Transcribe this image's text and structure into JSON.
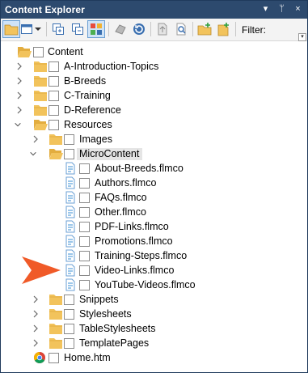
{
  "window": {
    "title": "Content Explorer",
    "controls": [
      "▾",
      "ᛘ",
      "×"
    ]
  },
  "toolbar": {
    "filter_label": "Filter:"
  },
  "tree": {
    "root": "Content",
    "a_intro": "A-Introduction-Topics",
    "b_breeds": "B-Breeds",
    "c_training": "C-Training",
    "d_reference": "D-Reference",
    "resources": "Resources",
    "images": "Images",
    "microcontent": "MicroContent",
    "files": [
      "About-Breeds.flmco",
      "Authors.flmco",
      "FAQs.flmco",
      "Other.flmco",
      "PDF-Links.flmco",
      "Promotions.flmco",
      "Training-Steps.flmco",
      "Video-Links.flmco",
      "YouTube-Videos.flmco"
    ],
    "snippets": "Snippets",
    "stylesheets": "Stylesheets",
    "tablestylesheets": "TableStylesheets",
    "templatepages": "TemplatePages",
    "home": "Home.htm"
  },
  "colors": {
    "titlebar": "#2d4a6e",
    "folder": "#f2c35c",
    "highlight_arrow": "#f05a28"
  }
}
